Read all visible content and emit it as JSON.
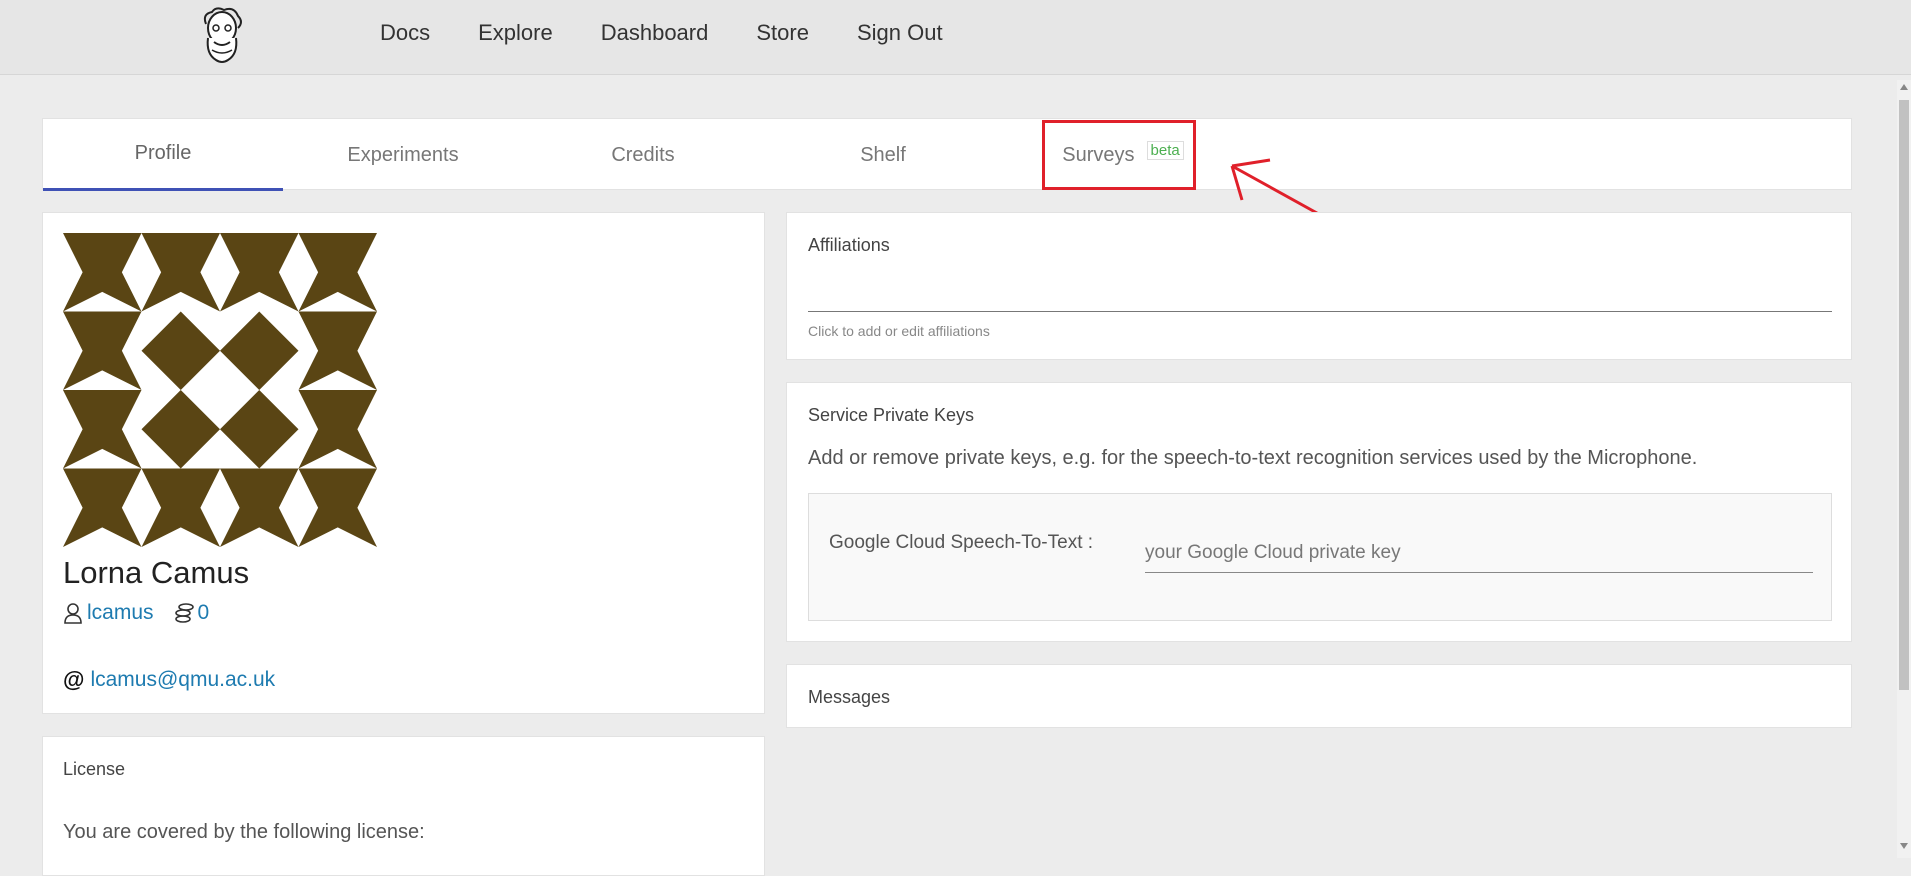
{
  "nav": {
    "logo": "bearded-face-logo",
    "items": [
      "Docs",
      "Explore",
      "Dashboard",
      "Store",
      "Sign Out"
    ]
  },
  "tabs": {
    "items": [
      {
        "label": "Profile",
        "active": true
      },
      {
        "label": "Experiments"
      },
      {
        "label": "Credits"
      },
      {
        "label": "Shelf"
      },
      {
        "label": "Surveys",
        "badge": "beta"
      }
    ],
    "active_color": "#3f51b5",
    "badge_color": "#4caf50"
  },
  "annotation": {
    "highlight_color": "#e0202a",
    "target": "Surveys"
  },
  "profile": {
    "name": "Lorna Camus",
    "username": "lcamus",
    "credits": "0",
    "email": "lcamus@qmu.ac.uk",
    "avatar_color": "#5a4514"
  },
  "license": {
    "title": "License",
    "text": "You are covered by the following license:"
  },
  "affiliations": {
    "title": "Affiliations",
    "hint": "Click to add or edit affiliations"
  },
  "keys": {
    "title": "Service Private Keys",
    "description": "Add or remove private keys, e.g. for the speech-to-text recognition services used by the Microphone.",
    "google_label": "Google Cloud Speech-To-Text :",
    "google_placeholder": "your Google Cloud private key"
  },
  "messages": {
    "title": "Messages"
  }
}
